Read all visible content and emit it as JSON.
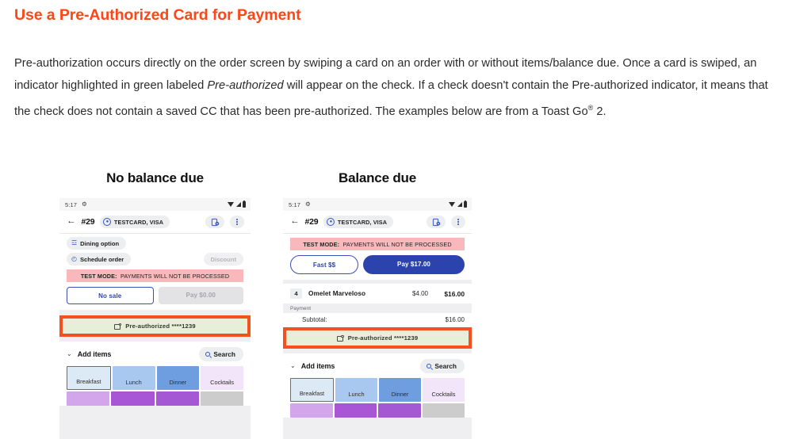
{
  "article": {
    "title": "Use a Pre-Authorized Card for Payment",
    "paragraph_part1": "Pre-authorization occurs directly on the order screen by swiping a card on an order with or without items/balance due. Once a card is swiped, an indicator highlighted in green labeled ",
    "paragraph_italic": "Pre-authorized",
    "paragraph_part2": " will appear on the check. If a check doesn't contain the Pre-authorized indicator, it means that the check does not contain a saved CC that has been pre-authorized. The examples below are from a Toast Go",
    "paragraph_sup": "®",
    "paragraph_part3": " 2.",
    "title_color": "#FF4616"
  },
  "examples": {
    "left_caption": "No balance due",
    "right_caption": "Balance due"
  },
  "phone_left": {
    "statusbar": {
      "time": "5:17",
      "gear_icon": "⚙",
      "wifi_icon": "wifi-icon",
      "signal_icon": "signal-icon",
      "battery_icon": "battery-icon"
    },
    "header": {
      "back_icon": "←",
      "order_number": "#29",
      "customer_name": "TESTCARD, VISA",
      "avatar_glyph": "●",
      "card_reader_icon": "card-reader-icon",
      "kebab_icon": "more-options-icon"
    },
    "chips": {
      "dining_option": "Dining option",
      "dining_glyph": "☲",
      "schedule_order": "Schedule order",
      "schedule_glyph": "◴",
      "discount": "Discount"
    },
    "test_mode": {
      "bold": "TEST MODE:",
      "rest": "PAYMENTS WILL NOT BE PROCESSED"
    },
    "actions": {
      "secondary": "No sale",
      "primary": "Pay $0.00"
    },
    "preauth": {
      "text": "Pre-authorized ****1239",
      "icon": "wallet-icon",
      "bg": "#e7efd8",
      "highlight": "#F4511E"
    },
    "add_items": {
      "label": "Add items",
      "chevron": "⌄",
      "search": "Search"
    },
    "categories": [
      {
        "label": "Breakfast",
        "color": "#dceaf6",
        "selected": true
      },
      {
        "label": "Lunch",
        "color": "#a9c8ef",
        "selected": false
      },
      {
        "label": "Dinner",
        "color": "#6f9ee0",
        "selected": false
      },
      {
        "label": "Cocktails",
        "color": "#f2e5fa",
        "selected": false
      }
    ],
    "categories_row2": [
      "#d3a6ec",
      "#a855d6",
      "#a558d4",
      "#cccccc"
    ]
  },
  "phone_right": {
    "statusbar": {
      "time": "5:17",
      "gear_icon": "⚙",
      "wifi_icon": "wifi-icon",
      "signal_icon": "signal-icon",
      "battery_icon": "battery-icon"
    },
    "header": {
      "back_icon": "←",
      "order_number": "#29",
      "customer_name": "TESTCARD, VISA",
      "avatar_glyph": "●",
      "card_reader_icon": "card-reader-icon",
      "kebab_icon": "more-options-icon"
    },
    "test_mode": {
      "bold": "TEST MODE:",
      "rest": "PAYMENTS WILL NOT BE PROCESSED"
    },
    "actions": {
      "secondary": "Fast $$",
      "primary": "Pay $17.00"
    },
    "items": [
      {
        "qty": "4",
        "name": "Omelet Marveloso",
        "unit_price": "$4.00",
        "line_total": "$16.00"
      }
    ],
    "payment_label": "Payment",
    "subtotal": {
      "label": "Subtotal:",
      "value": "$16.00"
    },
    "preauth": {
      "text": "Pre-authorized ****1239",
      "icon": "wallet-icon",
      "bg": "#e7efd8",
      "highlight": "#F4511E"
    },
    "add_items": {
      "label": "Add items",
      "chevron": "⌄",
      "search": "Search"
    },
    "categories": [
      {
        "label": "Breakfast",
        "color": "#dceaf6",
        "selected": true
      },
      {
        "label": "Lunch",
        "color": "#a9c8ef",
        "selected": false
      },
      {
        "label": "Dinner",
        "color": "#6f9ee0",
        "selected": false
      },
      {
        "label": "Cocktails",
        "color": "#f2e5fa",
        "selected": false
      }
    ],
    "categories_row2": [
      "#d3a6ec",
      "#a855d6",
      "#a558d4",
      "#cccccc"
    ]
  }
}
